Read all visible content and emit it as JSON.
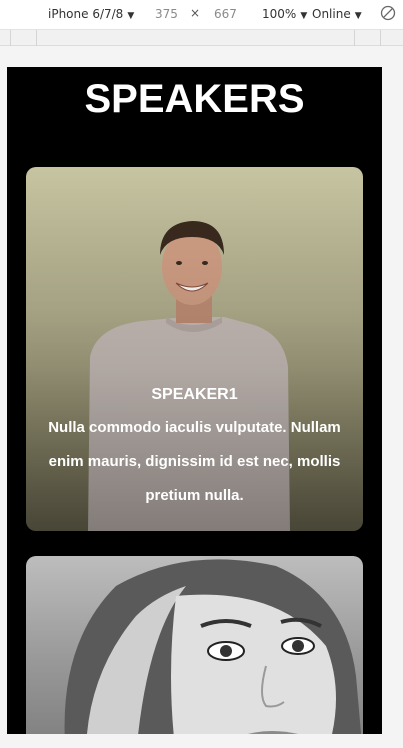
{
  "devtools": {
    "device": "iPhone 6/7/8",
    "width": "375",
    "times": "×",
    "height": "667",
    "zoom": "100%",
    "network": "Online"
  },
  "page": {
    "title": "SPEAKERS",
    "speakers": [
      {
        "name": "SPEAKER1",
        "description": "Nulla commodo iaculis vulputate. Nullam enim mauris, dignissim id est nec, mollis pretium nulla."
      }
    ]
  }
}
